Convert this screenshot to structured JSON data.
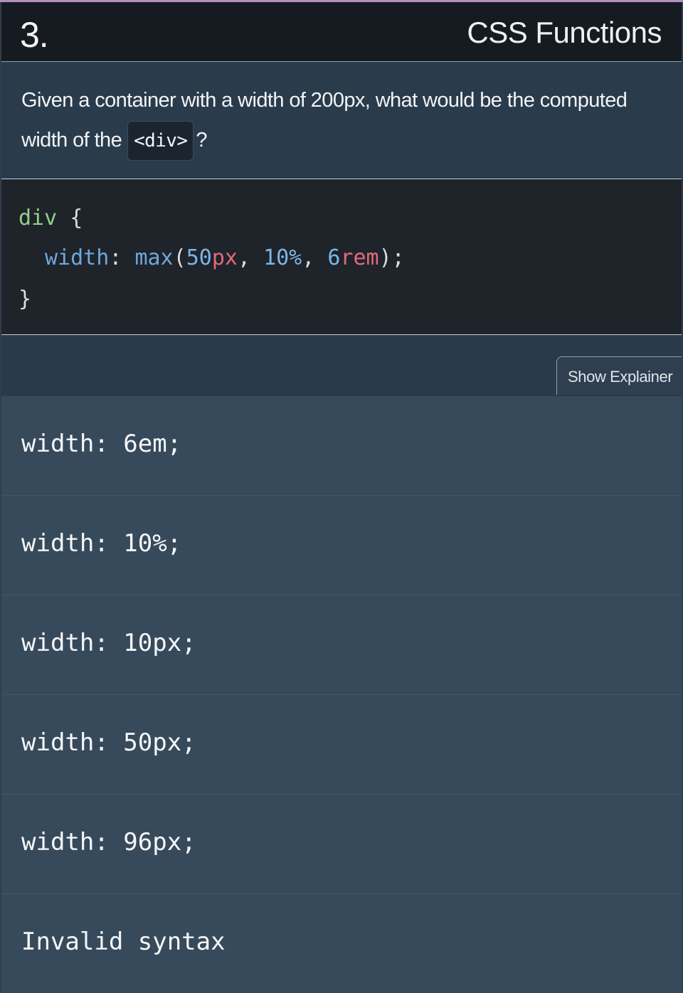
{
  "header": {
    "question_number": "3.",
    "topic": "CSS Functions"
  },
  "question": {
    "text_before": "Given a container with a width of 200px, what would be the computed width of the",
    "inline_code": "<div>",
    "text_after": "?"
  },
  "code": {
    "selector": "div",
    "open_brace": "{",
    "property": "width",
    "colon": ":",
    "function": "max",
    "paren_open": "(",
    "arg1_num": "50",
    "arg1_unit": "px",
    "comma": ",",
    "arg2_num": "10%",
    "arg3_num": "6",
    "arg3_unit": "rem",
    "paren_close": ");",
    "close_brace": "}"
  },
  "toolbar": {
    "explainer_label": "Show Explainer"
  },
  "answers": [
    {
      "label": "width: 6em;"
    },
    {
      "label": "width: 10%;"
    },
    {
      "label": "width: 10px;"
    },
    {
      "label": "width: 50px;"
    },
    {
      "label": "width: 96px;"
    },
    {
      "label": "Invalid syntax"
    }
  ]
}
